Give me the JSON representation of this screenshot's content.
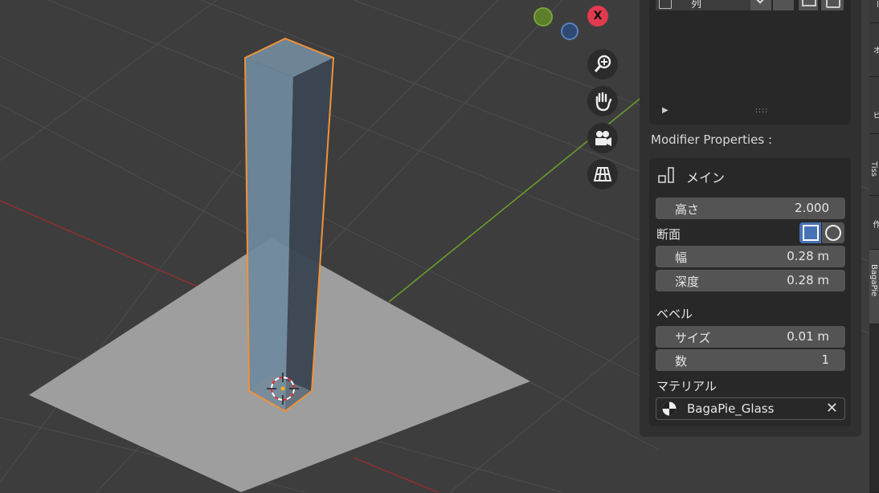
{
  "viewport": {
    "axis_x_label": "X"
  },
  "sublist": {
    "top_row_text": "列",
    "play_glyph": "▶",
    "grip_glyph": "::::"
  },
  "properties": {
    "header": "Modifier Properties :",
    "panel_title": "メイン",
    "height_label": "高さ",
    "height_value": "2.000",
    "section_label": "断面",
    "width_label": "幅",
    "width_value": "0.28 m",
    "depth_label": "深度",
    "depth_value": "0.28 m",
    "bevel_label": "ベベル",
    "size_label": "サイズ",
    "size_value": "0.01 m",
    "count_label": "数",
    "count_value": "1",
    "material_label": "マテリアル",
    "material_value": "BagaPie_Glass"
  },
  "tabs": [
    "ー",
    "オ",
    "ビ",
    "Tiss",
    "作",
    "BagaPie"
  ],
  "colors": {
    "selection": "#f0923a",
    "active_toggle": "#4772b3",
    "x_axis": "#e13a4e",
    "y_axis": "#6b9a2e",
    "z_axis": "#4d75b3"
  }
}
